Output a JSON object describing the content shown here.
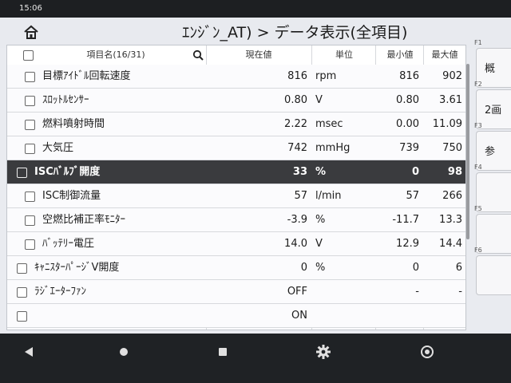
{
  "status": {
    "time": "15:06"
  },
  "header": {
    "title": "ｴﾝｼﾞﾝ_AT) > データ表示(全項目)"
  },
  "table": {
    "headers": {
      "name": "項目名(16/31)",
      "current": "現在値",
      "unit": "単位",
      "min": "最小値",
      "max": "最大値"
    },
    "rows": [
      {
        "name": "目標ｱｲﾄﾞﾙ回転速度",
        "current": "816",
        "unit": "rpm",
        "min": "816",
        "max": "902",
        "indent": 1
      },
      {
        "name": "ｽﾛｯﾄﾙｾﾝｻｰ",
        "current": "0.80",
        "unit": "V",
        "min": "0.80",
        "max": "3.61",
        "indent": 1
      },
      {
        "name": "燃料噴射時間",
        "current": "2.22",
        "unit": "msec",
        "min": "0.00",
        "max": "11.09",
        "indent": 1
      },
      {
        "name": "大気圧",
        "current": "742",
        "unit": "mmHg",
        "min": "739",
        "max": "750",
        "indent": 1
      },
      {
        "name": "ISCﾊﾞﾙﾌﾞ開度",
        "current": "33",
        "unit": "%",
        "min": "0",
        "max": "98",
        "indent": 0,
        "selected": true
      },
      {
        "name": "ISC制御流量",
        "current": "57",
        "unit": "l/min",
        "min": "57",
        "max": "266",
        "indent": 1
      },
      {
        "name": "空燃比補正率ﾓﾆﾀｰ",
        "current": "-3.9",
        "unit": "%",
        "min": "-11.7",
        "max": "13.3",
        "indent": 1
      },
      {
        "name": "ﾊﾞｯﾃﾘｰ電圧",
        "current": "14.0",
        "unit": "V",
        "min": "12.9",
        "max": "14.4",
        "indent": 1
      },
      {
        "name": "ｷｬﾆｽﾀｰﾊﾟｰｼﾞV開度",
        "current": "0",
        "unit": "%",
        "min": "0",
        "max": "6",
        "indent": 0
      },
      {
        "name": "ﾗｼﾞｴｰﾀｰﾌｧﾝ",
        "current": "OFF",
        "unit": "",
        "min": "-",
        "max": "-",
        "indent": 0
      },
      {
        "name": "",
        "current": "ON",
        "unit": "",
        "min": "",
        "max": "",
        "indent": 0
      }
    ]
  },
  "fkeys": [
    {
      "label": "F1",
      "text": "概"
    },
    {
      "label": "F2",
      "text": "2画"
    },
    {
      "label": "F3",
      "text": "参"
    },
    {
      "label": "F4",
      "text": ""
    },
    {
      "label": "F5",
      "text": ""
    },
    {
      "label": "F6",
      "text": ""
    }
  ],
  "icons": {
    "home": "home-icon",
    "search": "search-icon",
    "back": "back-icon",
    "nav_home": "circle-home-icon",
    "recents": "square-recents-icon",
    "settings": "gear-icon",
    "browser": "chrome-icon"
  },
  "colors": {
    "selected_row": "#3a3b3e",
    "navbar": "#1f2225"
  }
}
